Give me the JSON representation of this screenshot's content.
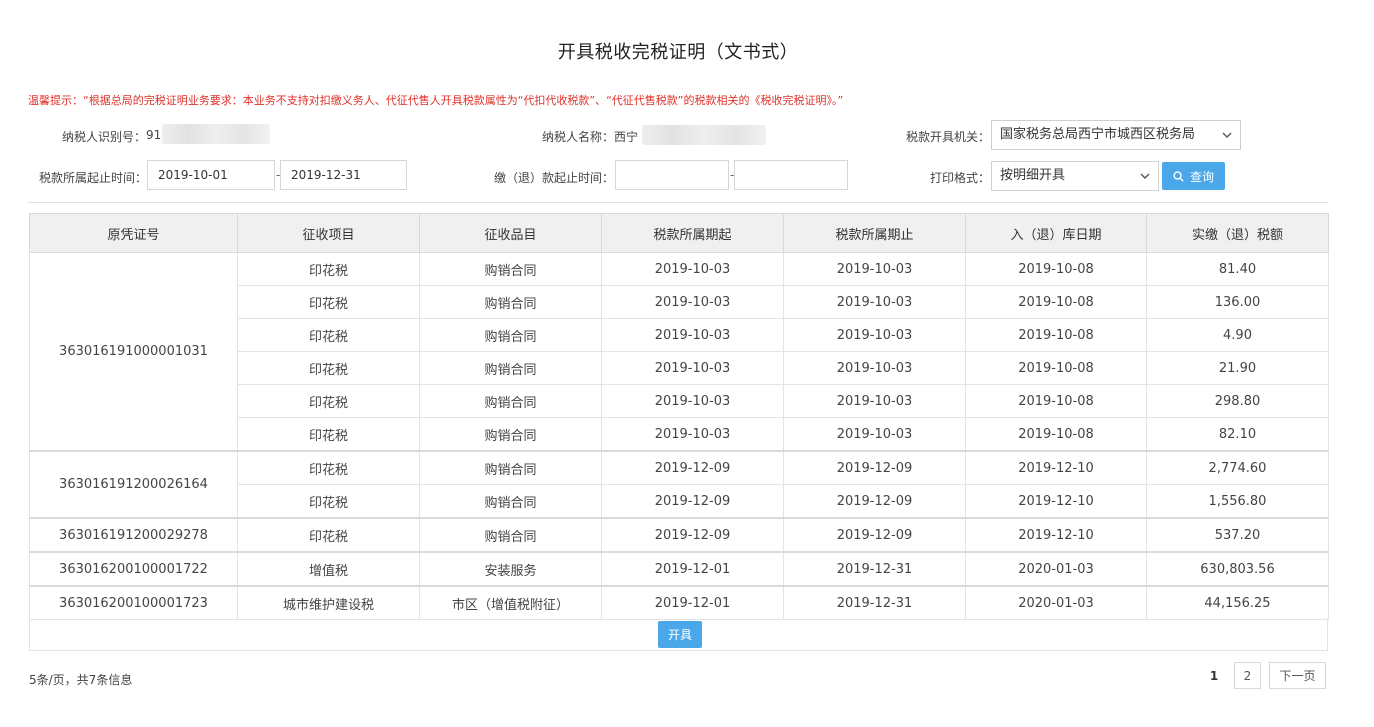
{
  "title": "开具税收完税证明（文书式）",
  "notice": "温馨提示：“根据总局的完税证明业务要求：本业务不支持对扣缴义务人、代征代售人开具税款属性为“代扣代收税款”、“代征代售税款”的税款相关的《税收完税证明》。”",
  "taxpayer": {
    "id_label": "纳税人识别号：",
    "id_value": "91",
    "name_label": "纳税人名称：",
    "name_value": "西宁"
  },
  "authority": {
    "label": "税款开具机关：",
    "selected": "国家税务总局西宁市城西区税务局"
  },
  "period": {
    "label": "税款所属起止时间：",
    "start": "2019-10-01",
    "end": "2019-12-31",
    "dash": "-"
  },
  "payment": {
    "label": "缴（退）款起止时间：",
    "start": "",
    "end": "",
    "dash": "-"
  },
  "print_format": {
    "label": "打印格式：",
    "selected": "按明细开具"
  },
  "query_button": "查询",
  "table": {
    "headers": [
      "原凭证号",
      "征收项目",
      "征收品目",
      "税款所属期起",
      "税款所属期止",
      "入（退）库日期",
      "实缴（退）税额"
    ],
    "groups": [
      {
        "voucher": "363016191000001031",
        "rows": [
          [
            "印花税",
            "购销合同",
            "2019-10-03",
            "2019-10-03",
            "2019-10-08",
            "81.40"
          ],
          [
            "印花税",
            "购销合同",
            "2019-10-03",
            "2019-10-03",
            "2019-10-08",
            "136.00"
          ],
          [
            "印花税",
            "购销合同",
            "2019-10-03",
            "2019-10-03",
            "2019-10-08",
            "4.90"
          ],
          [
            "印花税",
            "购销合同",
            "2019-10-03",
            "2019-10-03",
            "2019-10-08",
            "21.90"
          ],
          [
            "印花税",
            "购销合同",
            "2019-10-03",
            "2019-10-03",
            "2019-10-08",
            "298.80"
          ],
          [
            "印花税",
            "购销合同",
            "2019-10-03",
            "2019-10-03",
            "2019-10-08",
            "82.10"
          ]
        ]
      },
      {
        "voucher": "363016191200026164",
        "rows": [
          [
            "印花税",
            "购销合同",
            "2019-12-09",
            "2019-12-09",
            "2019-12-10",
            "2,774.60"
          ],
          [
            "印花税",
            "购销合同",
            "2019-12-09",
            "2019-12-09",
            "2019-12-10",
            "1,556.80"
          ]
        ]
      },
      {
        "voucher": "363016191200029278",
        "rows": [
          [
            "印花税",
            "购销合同",
            "2019-12-09",
            "2019-12-09",
            "2019-12-10",
            "537.20"
          ]
        ]
      },
      {
        "voucher": "363016200100001722",
        "rows": [
          [
            "增值税",
            "安装服务",
            "2019-12-01",
            "2019-12-31",
            "2020-01-03",
            "630,803.56"
          ]
        ]
      },
      {
        "voucher": "363016200100001723",
        "rows": [
          [
            "城市维护建设税",
            "市区（增值税附征）",
            "2019-12-01",
            "2019-12-31",
            "2020-01-03",
            "44,156.25"
          ]
        ]
      }
    ]
  },
  "issue_button": "开具",
  "pagination": {
    "info": "5条/页，共7条信息",
    "pages": [
      "1",
      "2"
    ],
    "next": "下一页"
  },
  "icons": {
    "query": "search-icon",
    "select_arrow": "chevron-down-icon"
  },
  "colors": {
    "notice": "#e0312a",
    "button": "#4aa7ea"
  }
}
